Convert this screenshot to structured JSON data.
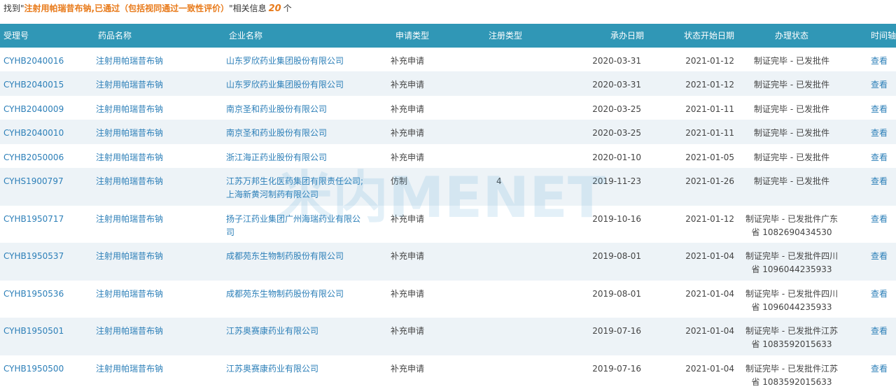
{
  "summary": {
    "prefix": "找到\"",
    "query": "注射用帕瑞昔布钠,已通过（包括视同通过一致性评价）",
    "middle": "\"相关信息",
    "count": "20",
    "suffix": "个"
  },
  "columns": [
    "受理号",
    "药品名称",
    "企业名称",
    "申请类型",
    "注册类型",
    "承办日期",
    "状态开始日期",
    "办理状态",
    "时间轴"
  ],
  "rows": [
    {
      "id": "CYHB2040016",
      "drug": "注射用帕瑞昔布钠",
      "company": "山东罗欣药业集团股份有限公司",
      "app_type": "补充申请",
      "reg_type": "",
      "date": "2020-03-31",
      "status_date": "2021-01-12",
      "status": "制证完毕 - 已发批件",
      "action": "查看"
    },
    {
      "id": "CYHB2040015",
      "drug": "注射用帕瑞昔布钠",
      "company": "山东罗欣药业集团股份有限公司",
      "app_type": "补充申请",
      "reg_type": "",
      "date": "2020-03-31",
      "status_date": "2021-01-12",
      "status": "制证完毕 - 已发批件",
      "action": "查看"
    },
    {
      "id": "CYHB2040009",
      "drug": "注射用帕瑞昔布钠",
      "company": "南京圣和药业股份有限公司",
      "app_type": "补充申请",
      "reg_type": "",
      "date": "2020-03-25",
      "status_date": "2021-01-11",
      "status": "制证完毕 - 已发批件",
      "action": "查看"
    },
    {
      "id": "CYHB2040010",
      "drug": "注射用帕瑞昔布钠",
      "company": "南京圣和药业股份有限公司",
      "app_type": "补充申请",
      "reg_type": "",
      "date": "2020-03-25",
      "status_date": "2021-01-11",
      "status": "制证完毕 - 已发批件",
      "action": "查看"
    },
    {
      "id": "CYHB2050006",
      "drug": "注射用帕瑞昔布钠",
      "company": "浙江海正药业股份有限公司",
      "app_type": "补充申请",
      "reg_type": "",
      "date": "2020-01-10",
      "status_date": "2021-01-05",
      "status": "制证完毕 - 已发批件",
      "action": "查看"
    },
    {
      "id": "CYHS1900797",
      "drug": "注射用帕瑞昔布钠",
      "company": "江苏万邦生化医药集团有限责任公司;",
      "company2": "上海新黄河制药有限公司",
      "app_type": "仿制",
      "reg_type": "4",
      "date": "2019-11-23",
      "status_date": "2021-01-26",
      "status": "制证完毕 - 已发批件",
      "action": "查看"
    },
    {
      "id": "CYHB1950717",
      "drug": "注射用帕瑞昔布钠",
      "company": "扬子江药业集团广州海瑞药业有限公",
      "company2": "司",
      "app_type": "补充申请",
      "reg_type": "",
      "date": "2019-10-16",
      "status_date": "2021-01-12",
      "status": "制证完毕 - 已发批件广东",
      "status2": "省 1082690434530",
      "action": "查看"
    },
    {
      "id": "CYHB1950537",
      "drug": "注射用帕瑞昔布钠",
      "company": "成都苑东生物制药股份有限公司",
      "app_type": "补充申请",
      "reg_type": "",
      "date": "2019-08-01",
      "status_date": "2021-01-04",
      "status": "制证完毕 - 已发批件四川",
      "status2": "省 1096044235933",
      "action": "查看"
    },
    {
      "id": "CYHB1950536",
      "drug": "注射用帕瑞昔布钠",
      "company": "成都苑东生物制药股份有限公司",
      "app_type": "补充申请",
      "reg_type": "",
      "date": "2019-08-01",
      "status_date": "2021-01-04",
      "status": "制证完毕 - 已发批件四川",
      "status2": "省 1096044235933",
      "action": "查看"
    },
    {
      "id": "CYHB1950501",
      "drug": "注射用帕瑞昔布钠",
      "company": "江苏奥赛康药业有限公司",
      "app_type": "补充申请",
      "reg_type": "",
      "date": "2019-07-16",
      "status_date": "2021-01-04",
      "status": "制证完毕 - 已发批件江苏",
      "status2": "省 1083592015633",
      "action": "查看"
    },
    {
      "id": "CYHB1950500",
      "drug": "注射用帕瑞昔布钠",
      "company": "江苏奥赛康药业有限公司",
      "app_type": "补充申请",
      "reg_type": "",
      "date": "2019-07-16",
      "status_date": "2021-01-04",
      "status": "制证完毕 - 已发批件江苏",
      "status2": "省 1083592015633",
      "action": "查看"
    }
  ],
  "watermark": {
    "text": "米内MENET"
  },
  "colors": {
    "header_bg": "#3097b6",
    "link": "#2c7fb8",
    "accent": "#e87a1a",
    "stripe": "#edf3f7"
  }
}
